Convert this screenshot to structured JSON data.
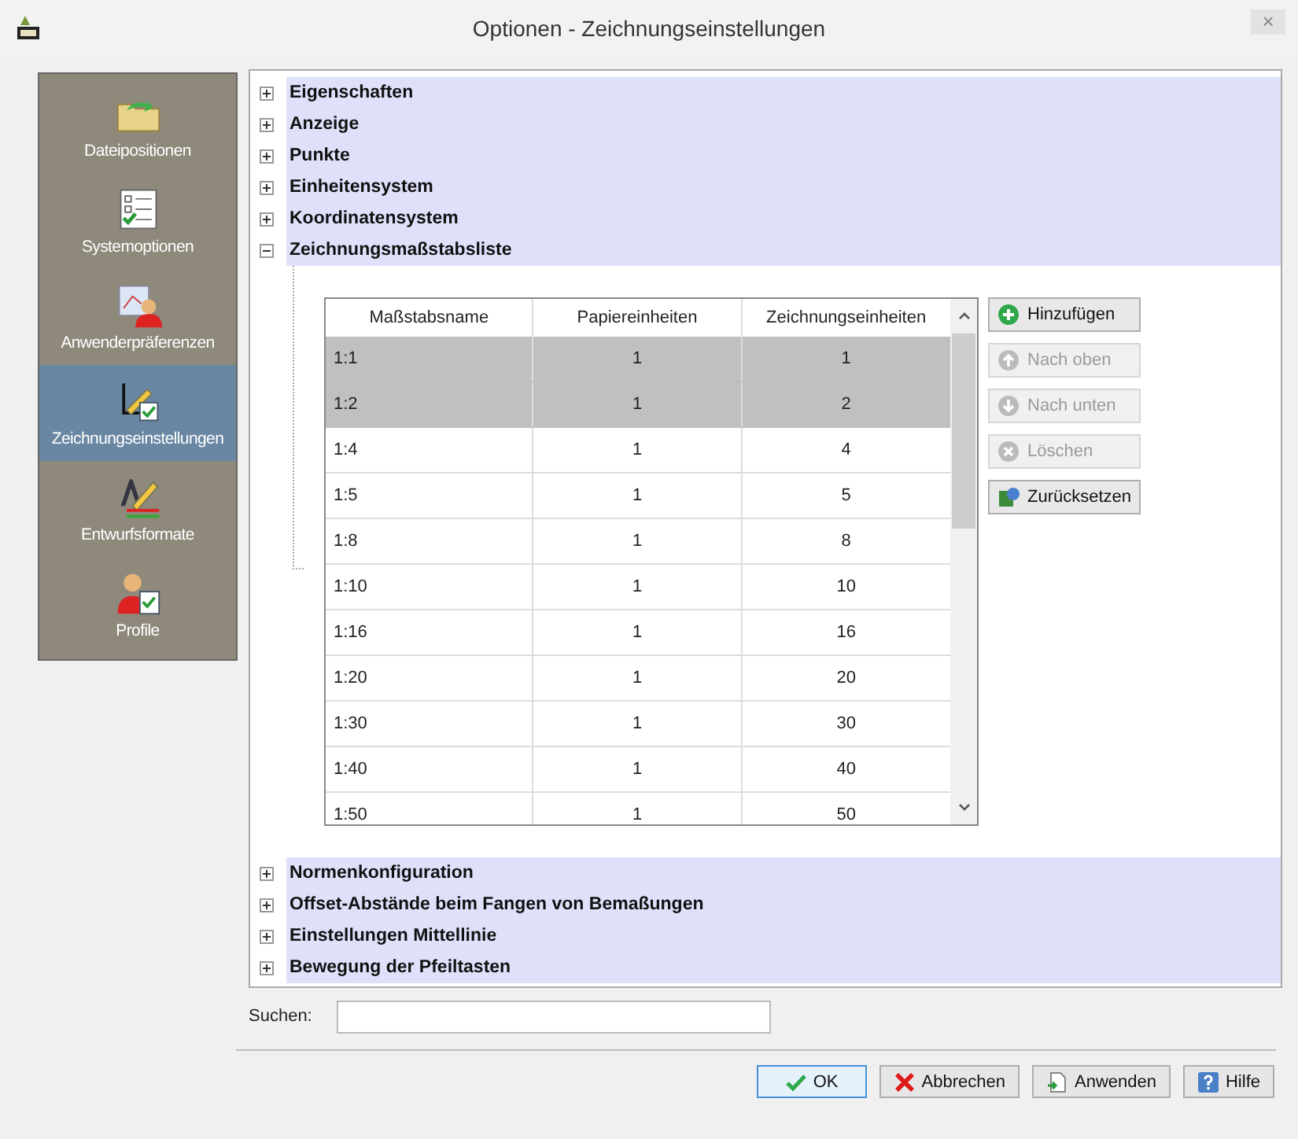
{
  "window": {
    "title": "Optionen - Zeichnungseinstellungen",
    "close": "×"
  },
  "sidebar": {
    "items": [
      {
        "label": "Dateipositionen",
        "kind": "folder",
        "selected": false
      },
      {
        "label": "Systemoptionen",
        "kind": "checklist",
        "selected": false
      },
      {
        "label": "Anwenderpräferenzen",
        "kind": "userchart",
        "selected": false
      },
      {
        "label": "Zeichnungseinstellungen",
        "kind": "drawing",
        "selected": true
      },
      {
        "label": "Entwurfsformate",
        "kind": "format",
        "selected": false
      },
      {
        "label": "Profile",
        "kind": "profile",
        "selected": false
      }
    ]
  },
  "tree": {
    "sections_before": [
      {
        "label": "Eigenschaften",
        "expanded": false
      },
      {
        "label": "Anzeige",
        "expanded": false
      },
      {
        "label": "Punkte",
        "expanded": false
      },
      {
        "label": "Einheitensystem",
        "expanded": false
      },
      {
        "label": "Koordinatensystem",
        "expanded": false
      },
      {
        "label": "Zeichnungsmaßstabsliste",
        "expanded": true
      }
    ],
    "scale_table": {
      "columns": [
        "Maßstabsname",
        "Papiereinheiten",
        "Zeichnungseinheiten"
      ],
      "rows": [
        {
          "cells": [
            "1:1",
            "1",
            "1"
          ],
          "selected": true
        },
        {
          "cells": [
            "1:2",
            "1",
            "2"
          ],
          "selected": true
        },
        {
          "cells": [
            "1:4",
            "1",
            "4"
          ],
          "selected": false
        },
        {
          "cells": [
            "1:5",
            "1",
            "5"
          ],
          "selected": false
        },
        {
          "cells": [
            "1:8",
            "1",
            "8"
          ],
          "selected": false
        },
        {
          "cells": [
            "1:10",
            "1",
            "10"
          ],
          "selected": false
        },
        {
          "cells": [
            "1:16",
            "1",
            "16"
          ],
          "selected": false
        },
        {
          "cells": [
            "1:20",
            "1",
            "20"
          ],
          "selected": false
        },
        {
          "cells": [
            "1:30",
            "1",
            "30"
          ],
          "selected": false
        },
        {
          "cells": [
            "1:40",
            "1",
            "40"
          ],
          "selected": false
        },
        {
          "cells": [
            "1:50",
            "1",
            "50"
          ],
          "selected": false
        }
      ]
    },
    "table_buttons": [
      {
        "label": "Hinzufügen",
        "kind": "add",
        "disabled": false
      },
      {
        "label": "Nach oben",
        "kind": "up",
        "disabled": true
      },
      {
        "label": "Nach unten",
        "kind": "down",
        "disabled": true
      },
      {
        "label": "Löschen",
        "kind": "delete",
        "disabled": true
      },
      {
        "label": "Zurücksetzen",
        "kind": "reset",
        "disabled": false
      }
    ],
    "sections_after": [
      {
        "label": "Normenkonfiguration",
        "expanded": false
      },
      {
        "label": "Offset-Abstände beim Fangen von Bemaßungen",
        "expanded": false
      },
      {
        "label": "Einstellungen Mittellinie",
        "expanded": false
      },
      {
        "label": "Bewegung der Pfeiltasten",
        "expanded": false
      }
    ]
  },
  "search": {
    "label": "Suchen:"
  },
  "buttons": [
    {
      "label": "OK",
      "kind": "check",
      "default": true
    },
    {
      "label": "Abbrechen",
      "kind": "cross",
      "default": false
    },
    {
      "label": "Anwenden",
      "kind": "apply",
      "default": false
    },
    {
      "label": "Hilfe",
      "kind": "help",
      "default": false
    }
  ]
}
